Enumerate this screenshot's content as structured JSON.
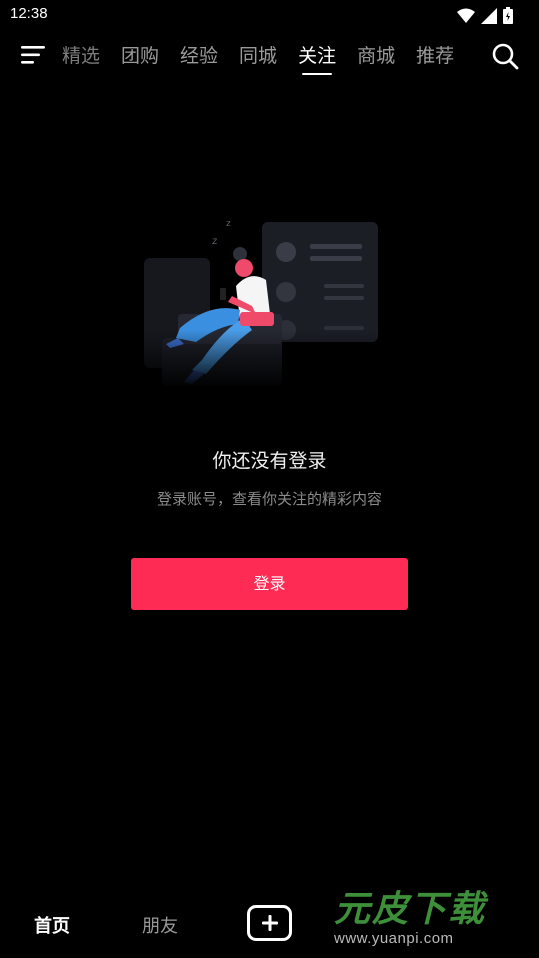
{
  "status_bar": {
    "time": "12:38"
  },
  "top_nav": {
    "tabs": [
      {
        "label": "精选"
      },
      {
        "label": "团购"
      },
      {
        "label": "经验"
      },
      {
        "label": "同城"
      },
      {
        "label": "关注"
      },
      {
        "label": "商城"
      },
      {
        "label": "推荐"
      }
    ],
    "active_tab": "关注"
  },
  "empty_state": {
    "title": "你还没有登录",
    "subtitle": "登录账号，查看你关注的精彩内容",
    "login_button": "登录"
  },
  "bottom_nav": {
    "home": "首页",
    "friends": "朋友"
  },
  "watermark": {
    "brand": "元皮下载",
    "url": "www.yuanpi.com"
  },
  "colors": {
    "accent": "#fe2c55",
    "background": "#000000",
    "illustration_pink": "#f04a6a",
    "illustration_blue": "#3b8fe0"
  }
}
